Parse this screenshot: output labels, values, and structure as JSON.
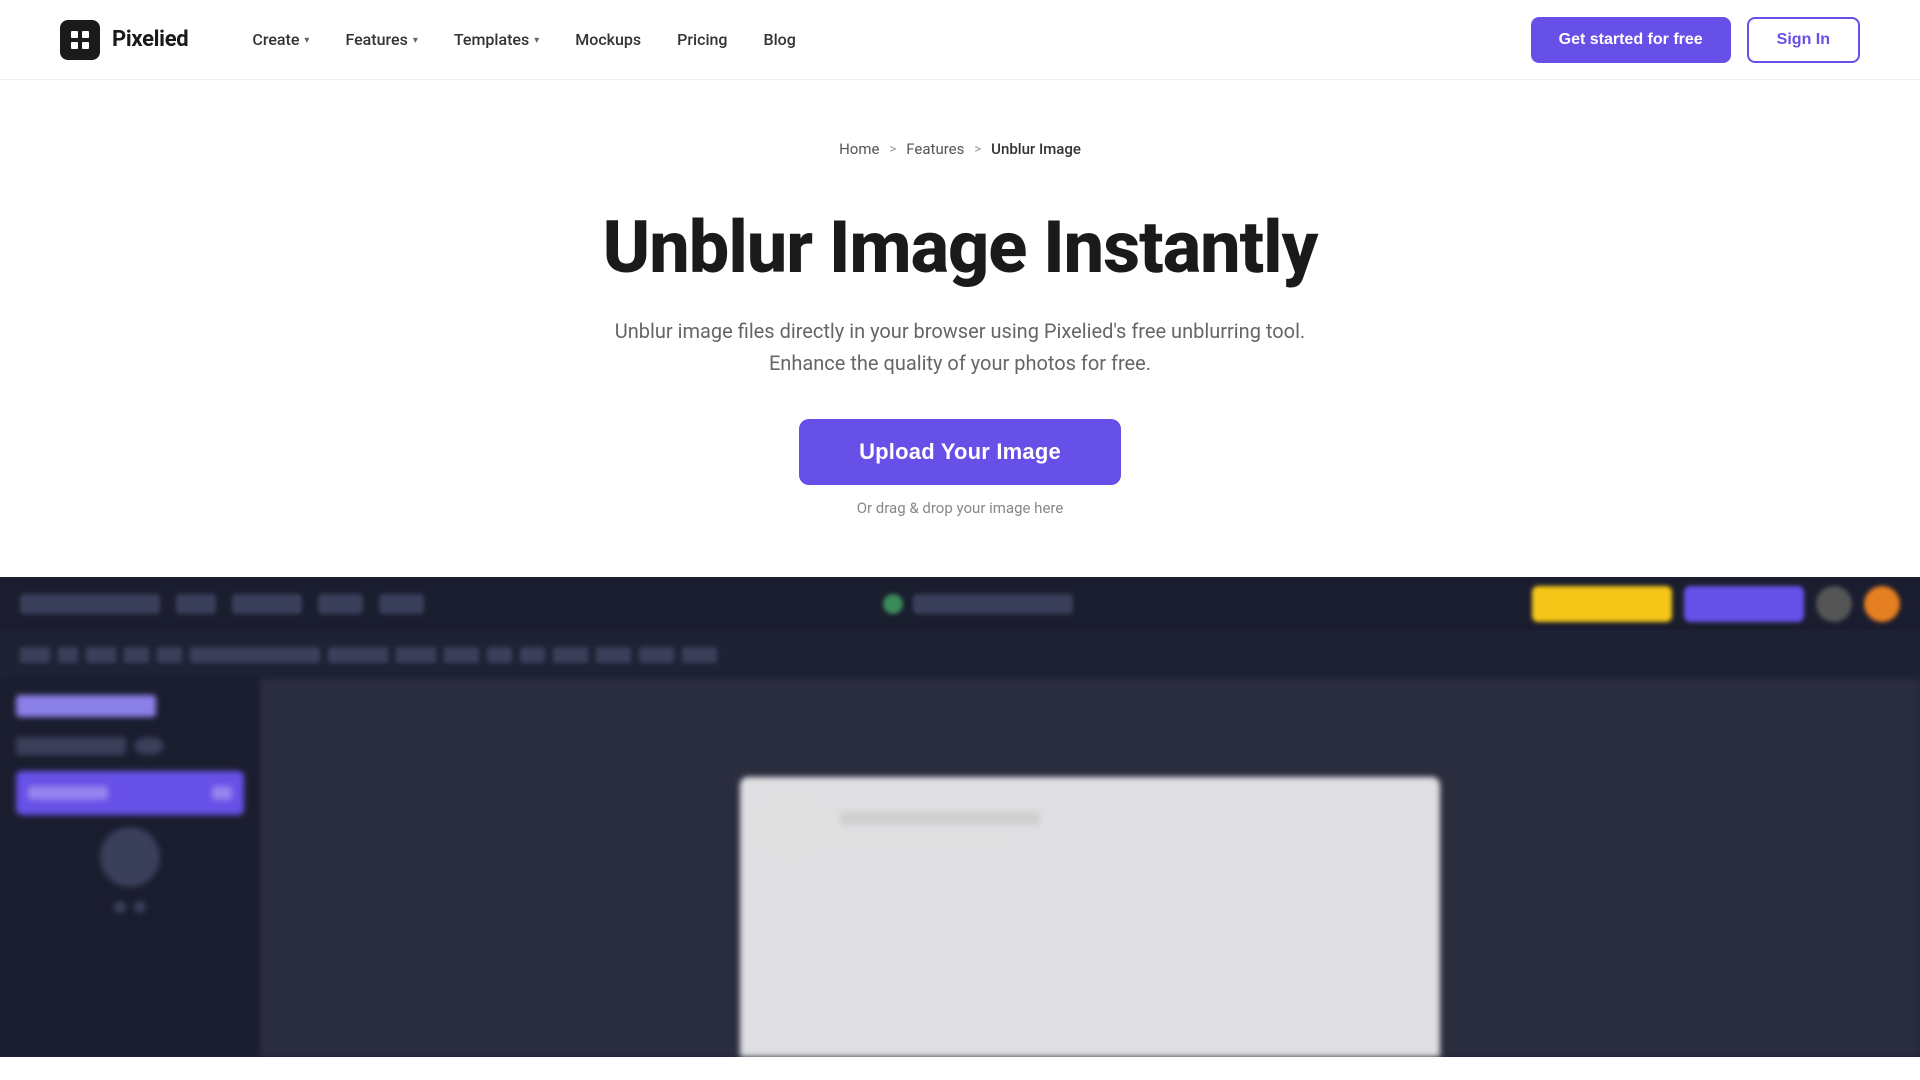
{
  "brand": {
    "name": "Pixelied",
    "logo_alt": "Pixelied logo"
  },
  "navbar": {
    "links": [
      {
        "label": "Create",
        "has_dropdown": true,
        "id": "create"
      },
      {
        "label": "Features",
        "has_dropdown": true,
        "id": "features"
      },
      {
        "label": "Templates",
        "has_dropdown": true,
        "id": "templates"
      },
      {
        "label": "Mockups",
        "has_dropdown": false,
        "id": "mockups"
      },
      {
        "label": "Pricing",
        "has_dropdown": false,
        "id": "pricing"
      },
      {
        "label": "Blog",
        "has_dropdown": false,
        "id": "blog"
      }
    ],
    "cta_primary": "Get started for free",
    "cta_secondary": "Sign In"
  },
  "breadcrumb": {
    "items": [
      {
        "label": "Home",
        "link": true
      },
      {
        "label": "Features",
        "link": true
      },
      {
        "label": "Unblur Image",
        "link": false
      }
    ],
    "separator": ">"
  },
  "hero": {
    "title": "Unblur Image Instantly",
    "subtitle_line1": "Unblur image files directly in your browser using Pixelied's free unblurring tool.",
    "subtitle_line2": "Enhance the quality of your photos for free.",
    "upload_button": "Upload Your Image",
    "drag_drop_text": "Or drag & drop your image here"
  },
  "colors": {
    "primary": "#6750e7",
    "primary_hover": "#5c45d4",
    "text_dark": "#1a1a1a",
    "text_muted": "#666666",
    "text_light": "#888888"
  }
}
